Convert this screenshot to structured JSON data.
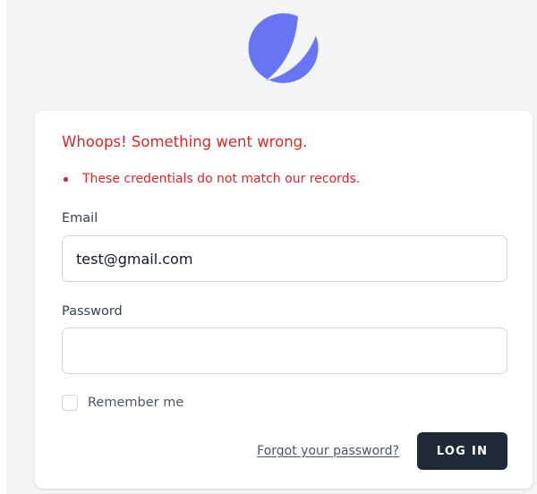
{
  "logo": {
    "icon": "app-logo-icon",
    "color": "#6875f5"
  },
  "error": {
    "title": "Whoops! Something went wrong.",
    "messages": [
      "These credentials do not match our records."
    ],
    "color": "#dc2626"
  },
  "form": {
    "email_label": "Email",
    "email_value": "test@gmail.com",
    "password_label": "Password",
    "password_value": "",
    "remember_label": "Remember me",
    "remember_checked": false,
    "forgot_link": "Forgot your password?",
    "submit_label": "LOG IN"
  },
  "colors": {
    "page_background": "#f3f4f6",
    "card_background": "#ffffff",
    "button_background": "#1f2937"
  }
}
